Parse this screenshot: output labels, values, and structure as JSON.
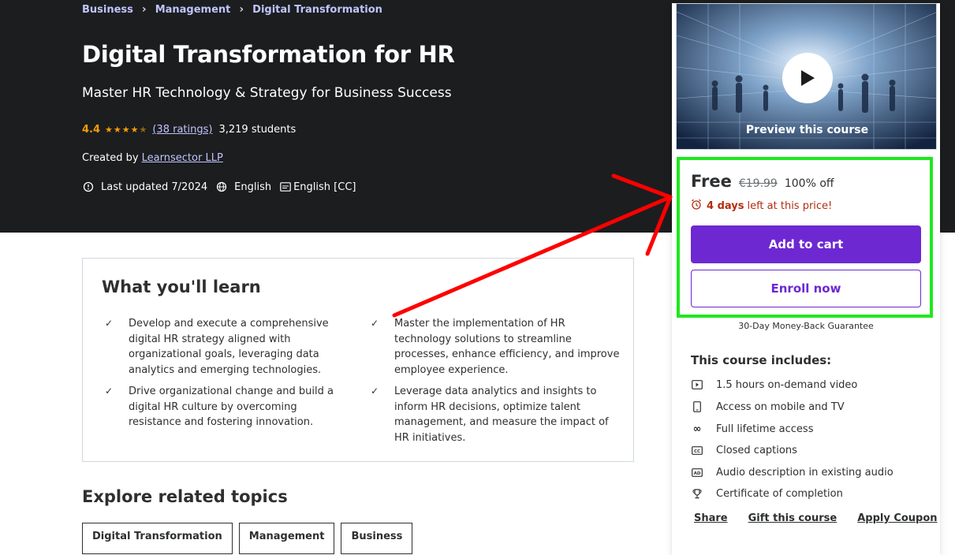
{
  "breadcrumb": {
    "items": [
      "Business",
      "Management",
      "Digital Transformation"
    ]
  },
  "course": {
    "title": "Digital Transformation for HR",
    "subtitle": "Master HR Technology & Strategy for Business Success",
    "rating": "4.4",
    "rating_value": 4.4,
    "ratings_count": "(38 ratings)",
    "students": "3,219 students",
    "created_by_label": "Created by",
    "creator": "Learnsector LLP",
    "last_updated": "Last updated 7/2024",
    "language": "English",
    "captions": "English [CC]"
  },
  "learn": {
    "title": "What you'll learn",
    "items": [
      "Develop and execute a comprehensive digital HR strategy aligned with organizational goals, leveraging data analytics and emerging technologies.",
      "Master the implementation of HR technology solutions to streamline processes, enhance efficiency, and improve employee experience.",
      "Drive organizational change and build a digital HR culture by overcoming resistance and fostering innovation.",
      "Leverage data analytics and insights to inform HR decisions, optimize talent management, and measure the impact of HR initiatives."
    ]
  },
  "explore": {
    "title": "Explore related topics",
    "topics": [
      "Digital Transformation",
      "Management",
      "Business"
    ]
  },
  "sidebar": {
    "preview_label": "Preview this course",
    "price": "Free",
    "original_price": "€19.99",
    "discount": "100% off",
    "timer_days": "4 days",
    "timer_text": "left at this price!",
    "add_to_cart": "Add to cart",
    "enroll_now": "Enroll now",
    "guarantee": "30-Day Money-Back Guarantee",
    "includes_title": "This course includes:",
    "includes": [
      "1.5 hours on-demand video",
      "Access on mobile and TV",
      "Full lifetime access",
      "Closed captions",
      "Audio description in existing audio",
      "Certificate of completion"
    ],
    "share": "Share",
    "gift": "Gift this course",
    "coupon": "Apply Coupon"
  },
  "colors": {
    "hero_bg": "#1c1d1f",
    "accent_purple": "#6d28d2",
    "star_orange": "#f69c08",
    "link_lavender": "#c0c4fc",
    "highlight_green": "#1ee81e",
    "arrow_red": "#ff0000",
    "timer_red": "#b32d0f"
  }
}
